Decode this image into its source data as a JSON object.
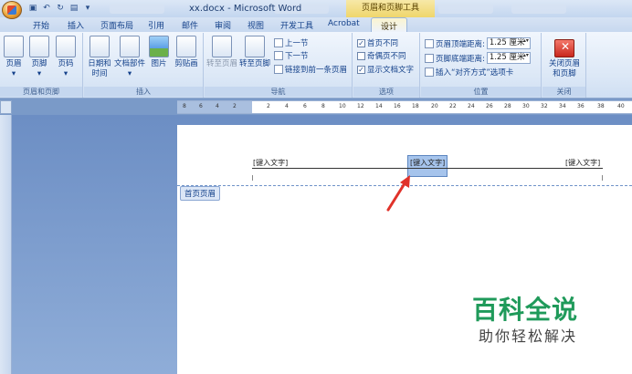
{
  "window": {
    "title": "xx.docx - Microsoft Word",
    "context_tab_title": "页眉和页脚工具"
  },
  "tabs": [
    "开始",
    "插入",
    "页面布局",
    "引用",
    "邮件",
    "审阅",
    "视图",
    "开发工具",
    "Acrobat",
    "设计"
  ],
  "ribbon": {
    "groups": {
      "hf": {
        "label": "页眉和页脚",
        "buttons": [
          "页眉",
          "页脚",
          "页码"
        ]
      },
      "insert": {
        "label": "插入",
        "buttons": [
          "日期和\n时间",
          "文档部件",
          "图片",
          "剪贴画"
        ]
      },
      "nav": {
        "label": "导航",
        "goto_header": "转至页眉",
        "goto_footer": "转至页脚",
        "prev": "上一节",
        "next": "下一节",
        "link_prev": "链接到前一条页眉"
      },
      "options": {
        "label": "选项",
        "first_page": "首页不同",
        "odd_even": "奇偶页不同",
        "show_text": "显示文档文字"
      },
      "position": {
        "label": "位置",
        "header_dist_label": "页眉顶端距离:",
        "header_dist": "1.25 厘米",
        "footer_dist_label": "页脚底端距离:",
        "footer_dist": "1.25 厘米",
        "insert_align": "插入“对齐方式”选项卡"
      },
      "close": {
        "label": "关闭",
        "button": "关闭页眉\n和页脚"
      }
    },
    "checks": {
      "first_page": true,
      "odd_even": false,
      "show_text": true
    }
  },
  "ruler": {
    "numbers": [
      "8",
      "6",
      "4",
      "2",
      "2",
      "4",
      "6",
      "8",
      "10",
      "12",
      "14",
      "16",
      "18",
      "20",
      "22",
      "24",
      "26",
      "28",
      "30",
      "32",
      "34",
      "36",
      "38",
      "40"
    ]
  },
  "document": {
    "header_left": "[键入文字]",
    "header_center": "[键入文字]",
    "header_right": "[键入文字]",
    "header_label": "首页页眉"
  },
  "watermark": {
    "line1": "百科全说",
    "line2": "助你轻松解决"
  },
  "colors": {
    "ribbon_blue": "#15428b",
    "context_yellow": "#efd66b",
    "close_red": "#c8281e",
    "watermark_green": "#1f9a5a"
  }
}
